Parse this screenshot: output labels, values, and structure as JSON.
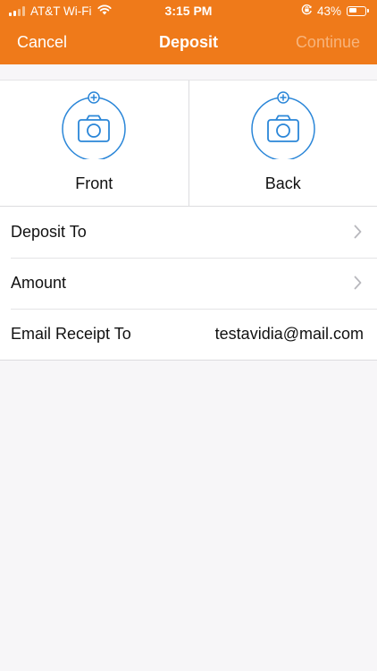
{
  "status_bar": {
    "carrier": "AT&T Wi-Fi",
    "time": "3:15 PM",
    "battery": "43%",
    "icons": [
      "signal-icon",
      "wifi-icon",
      "orientation-lock-icon",
      "battery-icon"
    ]
  },
  "nav": {
    "cancel_label": "Cancel",
    "title": "Deposit",
    "continue_label": "Continue"
  },
  "capture": {
    "front_label": "Front",
    "back_label": "Back"
  },
  "form": {
    "deposit_to_label": "Deposit To",
    "amount_label": "Amount",
    "email_label": "Email Receipt To",
    "email_value": "testavidia@mail.com"
  },
  "colors": {
    "header": "#ef7a1a",
    "accent_blue": "#2a86d8",
    "continue_disabled": "#f7b47c",
    "background": "#f7f6f8"
  }
}
